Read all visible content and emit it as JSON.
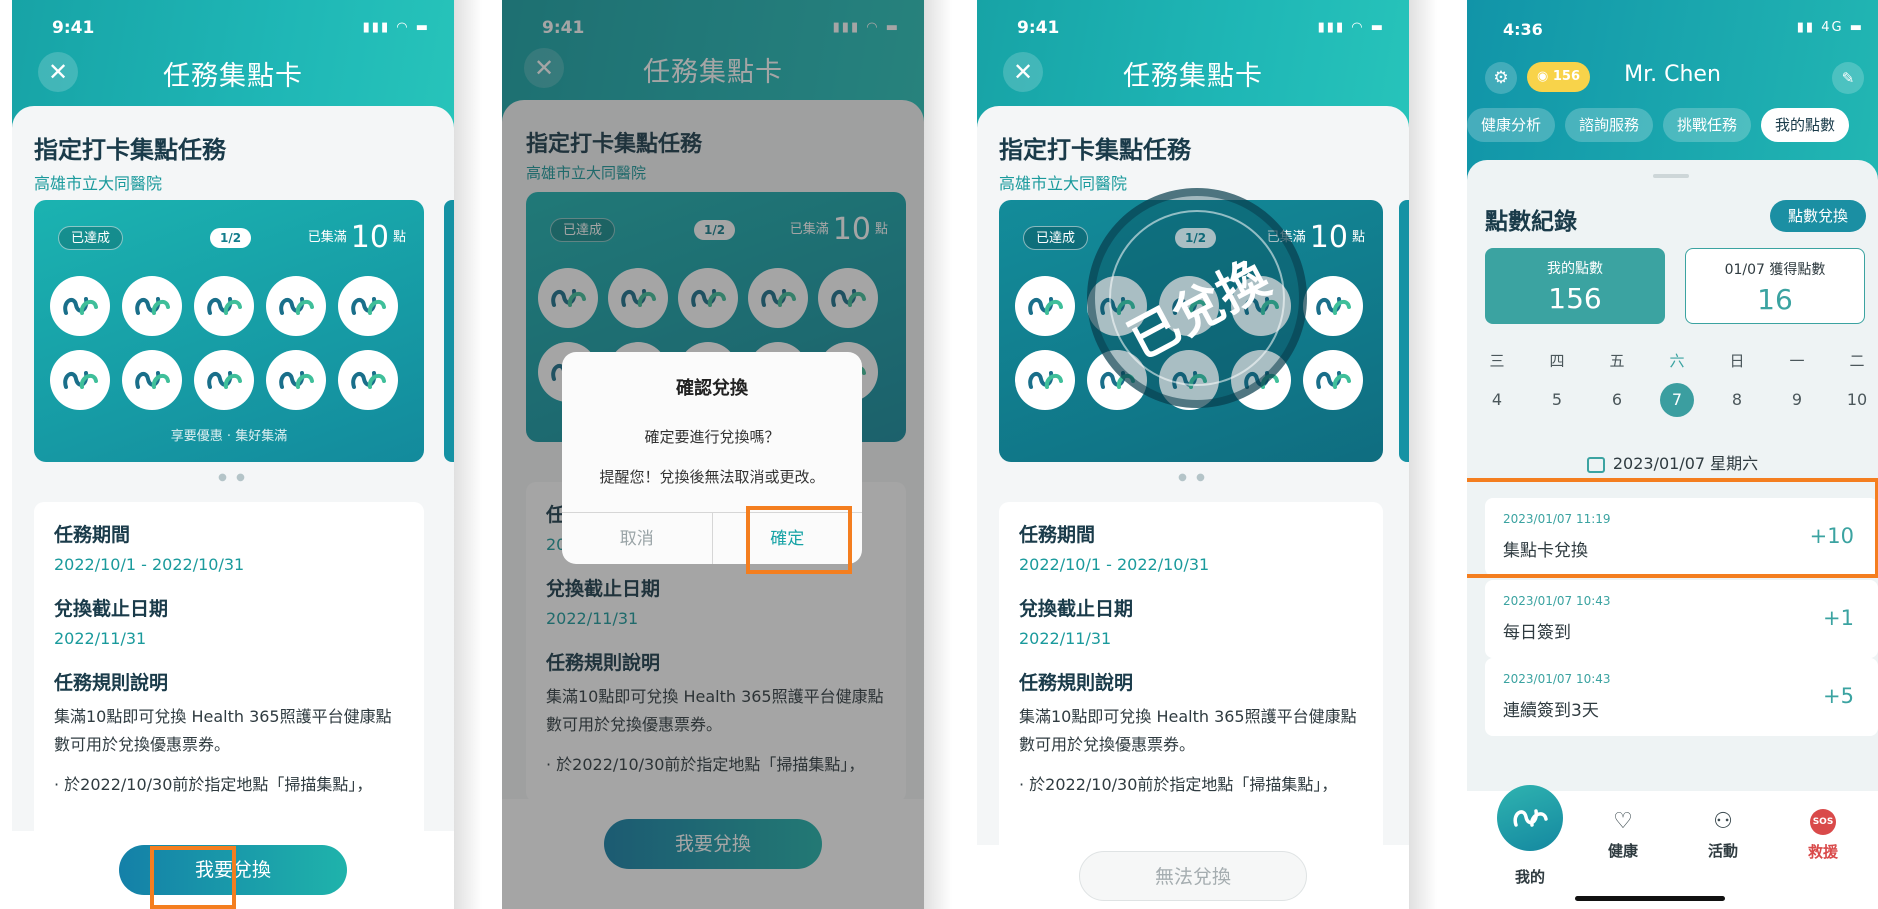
{
  "screens": [
    {
      "status_time": "9:41",
      "title": "任務集點卡",
      "task_title": "指定打卡集點任務",
      "location": "高雄市立大同醫院",
      "card": {
        "status_pill": "已達成",
        "fraction": "1/2",
        "collected_prefix": "已集滿",
        "collected_count": "10",
        "collected_suffix": "點",
        "footnote": "享要優惠 · 集好集滿"
      },
      "info": {
        "period_label": "任務期間",
        "period_value": "2022/10/1 - 2022/10/31",
        "deadline_label": "兌換截止日期",
        "deadline_value": "2022/11/31",
        "rules_label": "任務規則說明",
        "rules_text": "集滿10點即可兌換 Health 365照護平台健康點數可用於兌換優惠票券。",
        "bullet_text": "· 於2022/10/30前於指定地點「掃描集點」，"
      },
      "action_button": "我要兌換"
    },
    {
      "status_time": "9:41",
      "title": "任務集點卡",
      "task_title": "指定打卡集點任務",
      "location": "高雄市立大同醫院",
      "card": {
        "status_pill": "已達成",
        "fraction": "1/2",
        "collected_prefix": "已集滿",
        "collected_count": "10",
        "collected_suffix": "點"
      },
      "info_peek_1": "任",
      "info_peek_2": "20",
      "info": {
        "deadline_label": "兌換截止日期",
        "deadline_value": "2022/11/31",
        "rules_label": "任務規則說明",
        "rules_text": "集滿10點即可兌換 Health 365照護平台健康點數可用於兌換優惠票券。",
        "bullet_text": "· 於2022/10/30前於指定地點「掃描集點」，"
      },
      "dialog": {
        "title": "確認兌換",
        "message": "確定要進行兌換嗎？",
        "warning": "提醒您！兌換後無法取消或更改。",
        "cancel": "取消",
        "confirm": "確定"
      },
      "action_button": "我要兌換"
    },
    {
      "status_time": "9:41",
      "title": "任務集點卡",
      "task_title": "指定打卡集點任務",
      "location": "高雄市立大同醫院",
      "card": {
        "status_pill": "已達成",
        "fraction": "1/2",
        "collected_prefix": "已集滿",
        "collected_count": "10",
        "collected_suffix": "點"
      },
      "redeemed_stamp": "已兌換",
      "info": {
        "period_label": "任務期間",
        "period_value": "2022/10/1 - 2022/10/31",
        "deadline_label": "兌換截止日期",
        "deadline_value": "2022/11/31",
        "rules_label": "任務規則說明",
        "rules_text": "集滿10點即可兌換 Health 365照護平台健康點數可用於兌換優惠票券。",
        "bullet_text": "· 於2022/10/30前於指定地點「掃描集點」，"
      },
      "action_button": "無法兌換"
    }
  ],
  "points_screen": {
    "status_time": "4:36",
    "status_network": "4G",
    "points_badge": "156",
    "user_name": "Mr. Chen",
    "tabs": [
      "健康分析",
      "諮詢服務",
      "挑戰任務",
      "我的點數"
    ],
    "section_title": "點數紀錄",
    "redeem_button": "點數兌換",
    "my_points_label": "我的點數",
    "my_points_value": "156",
    "today_label": "01/07 獲得點數",
    "today_value": "16",
    "week": [
      {
        "day": "三",
        "date": "4"
      },
      {
        "day": "四",
        "date": "5"
      },
      {
        "day": "五",
        "date": "6"
      },
      {
        "day": "六",
        "date": "7"
      },
      {
        "day": "日",
        "date": "8"
      },
      {
        "day": "一",
        "date": "9"
      },
      {
        "day": "二",
        "date": "10"
      }
    ],
    "selected_date": "2023/01/07 星期六",
    "records": [
      {
        "time": "2023/01/07 11:19",
        "desc": "集點卡兌換",
        "value": "+10"
      },
      {
        "time": "2023/01/07 10:43",
        "desc": "每日簽到",
        "value": "+1"
      },
      {
        "time": "2023/01/07 10:43",
        "desc": "連續簽到3天",
        "value": "+5"
      }
    ],
    "nav": {
      "me": "我的",
      "health": "健康",
      "activity": "活動",
      "sos_badge": "SOS",
      "rescue": "救援"
    }
  },
  "colors": {
    "accent": "#1fb7b6",
    "highlight": "#f47e1f",
    "sos": "#d94a4a"
  }
}
